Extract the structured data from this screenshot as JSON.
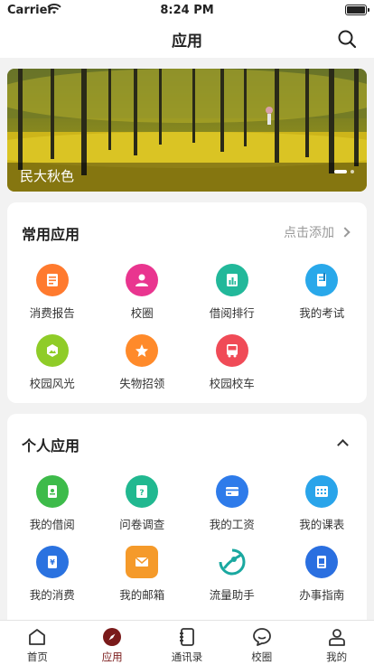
{
  "status_bar": {
    "carrier": "Carrier",
    "time": "8:24 PM"
  },
  "header": {
    "title": "应用",
    "search_icon": "search-icon"
  },
  "banner": {
    "caption": "民大秋色",
    "slide_count": 2,
    "active_slide": 1
  },
  "common_apps": {
    "title": "常用应用",
    "action_label": "点击添加",
    "items": [
      {
        "label": "消费报告",
        "icon": "receipt-icon",
        "color": "#ff7a2e"
      },
      {
        "label": "校圈",
        "icon": "community-icon",
        "color": "#e9358f"
      },
      {
        "label": "借阅排行",
        "icon": "ranking-icon",
        "color": "#22b89a"
      },
      {
        "label": "我的考试",
        "icon": "exam-icon",
        "color": "#29a8ea"
      },
      {
        "label": "校园风光",
        "icon": "scenery-icon",
        "color": "#8fcc28"
      },
      {
        "label": "失物招领",
        "icon": "lost-found-icon",
        "color": "#ff8a2a"
      },
      {
        "label": "校园校车",
        "icon": "bus-icon",
        "color": "#f04b57"
      }
    ]
  },
  "personal_apps": {
    "title": "个人应用",
    "items": [
      {
        "label": "我的借阅",
        "icon": "borrow-book-icon",
        "color": "#3dbb4a"
      },
      {
        "label": "问卷调查",
        "icon": "survey-icon",
        "color": "#21b890"
      },
      {
        "label": "我的工资",
        "icon": "salary-card-icon",
        "color": "#2e7bea"
      },
      {
        "label": "我的课表",
        "icon": "timetable-icon",
        "color": "#29a4ea"
      },
      {
        "label": "我的消费",
        "icon": "consumption-icon",
        "color": "#2a72e0"
      },
      {
        "label": "我的邮箱",
        "icon": "mailbox-icon",
        "color": "#f59a2a"
      },
      {
        "label": "流量助手",
        "icon": "data-traffic-icon",
        "color": "#1aa8a0"
      },
      {
        "label": "办事指南",
        "icon": "guide-icon",
        "color": "#2a6fe0"
      }
    ]
  },
  "tab_bar": {
    "active_color": "#7a1a1a",
    "items": [
      {
        "label": "首页",
        "icon": "home-icon"
      },
      {
        "label": "应用",
        "icon": "compass-icon"
      },
      {
        "label": "通讯录",
        "icon": "contacts-icon"
      },
      {
        "label": "校圈",
        "icon": "chat-bubble-icon"
      },
      {
        "label": "我的",
        "icon": "profile-icon"
      }
    ]
  }
}
